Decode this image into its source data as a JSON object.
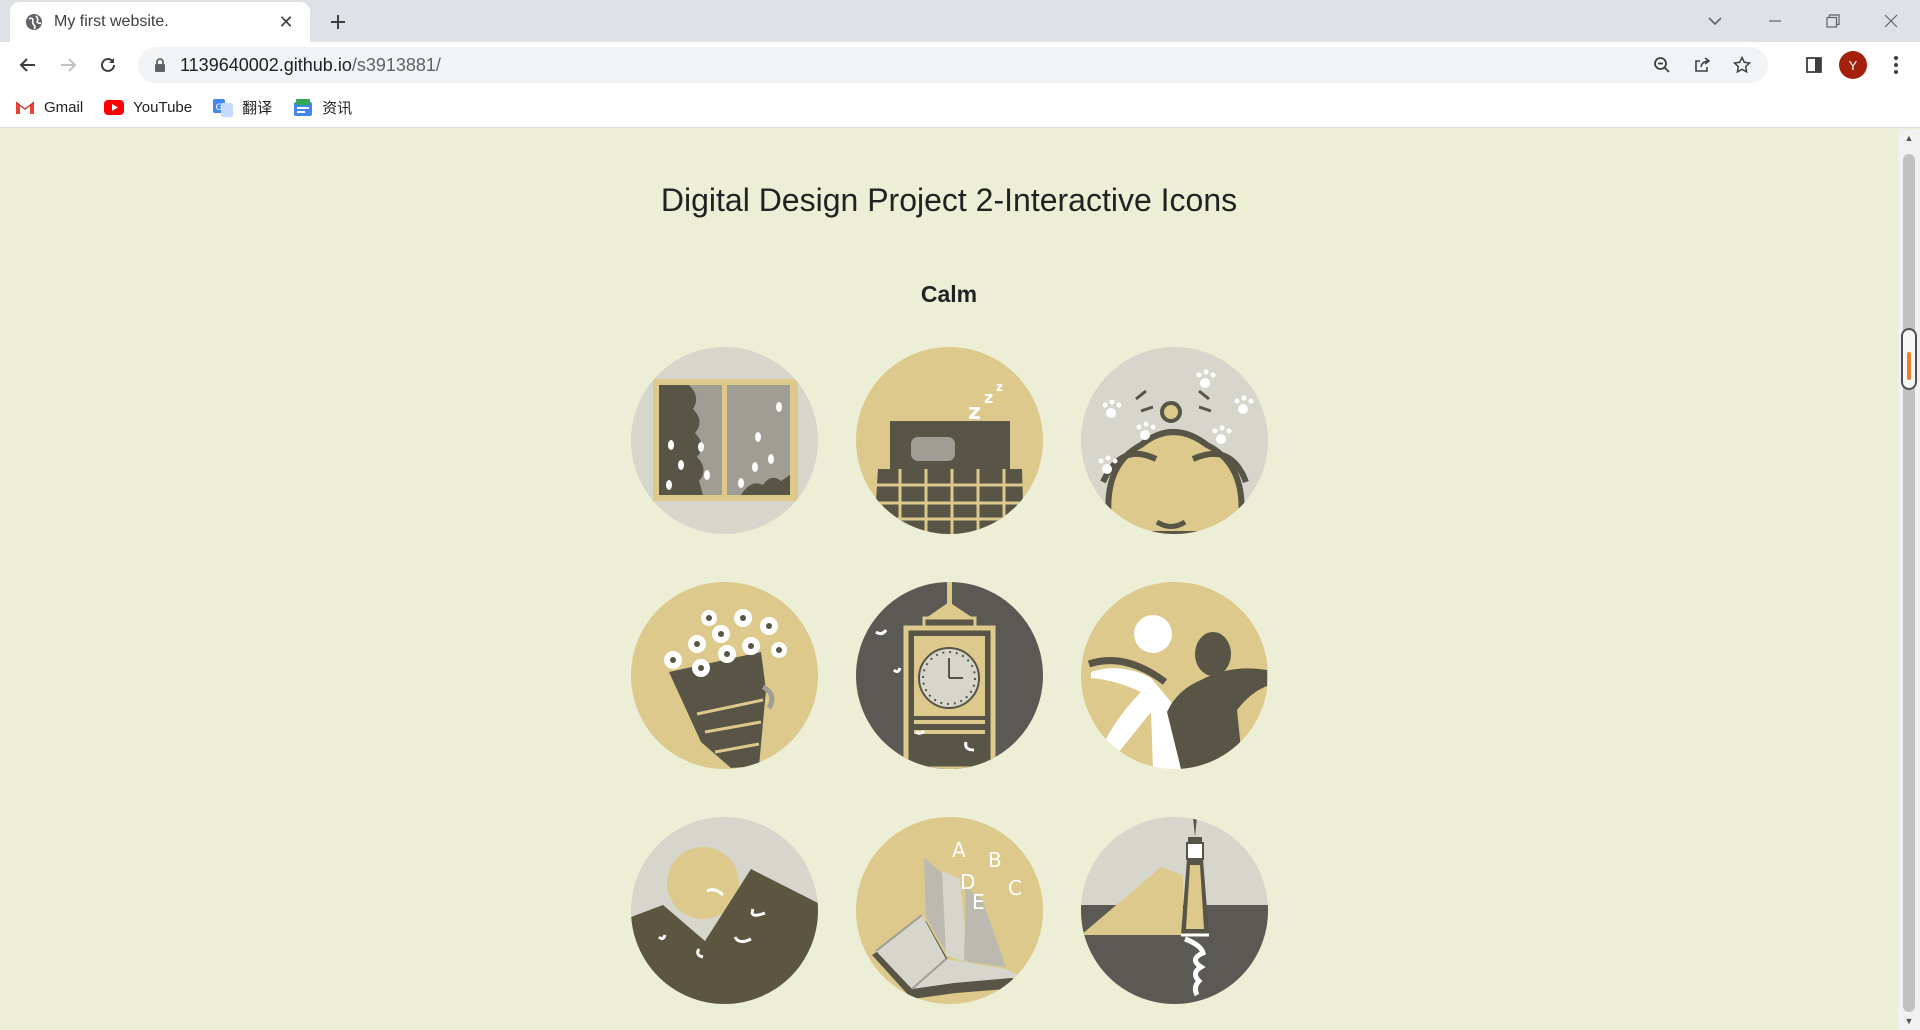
{
  "browser": {
    "tab_title": "My first website.",
    "url_host": "1139640002.github.io",
    "url_path": "/s3913881/",
    "profile_initial": "Y",
    "bookmarks": [
      {
        "label": "Gmail",
        "icon": "gmail-icon"
      },
      {
        "label": "YouTube",
        "icon": "youtube-icon"
      },
      {
        "label": "翻译",
        "icon": "translate-icon"
      },
      {
        "label": "资讯",
        "icon": "news-icon"
      }
    ]
  },
  "page": {
    "title": "Digital Design Project 2-Interactive Icons",
    "section_title": "Calm",
    "icons": [
      {
        "name": "rainy-window-icon"
      },
      {
        "name": "sleeping-bed-icon"
      },
      {
        "name": "cat-paws-icon"
      },
      {
        "name": "flower-bouquet-icon"
      },
      {
        "name": "clock-tower-icon"
      },
      {
        "name": "embracing-people-icon"
      },
      {
        "name": "mountain-sunset-icon"
      },
      {
        "name": "open-book-icon"
      },
      {
        "name": "lighthouse-icon"
      }
    ]
  },
  "colors": {
    "page_background": "#edeed6",
    "icon_gold": "#dcc98b",
    "icon_dark": "#5b5954",
    "icon_light_gray": "#d7d6cc",
    "icon_olive": "#5c5540",
    "scroll_accent": "#ef7d2d"
  }
}
